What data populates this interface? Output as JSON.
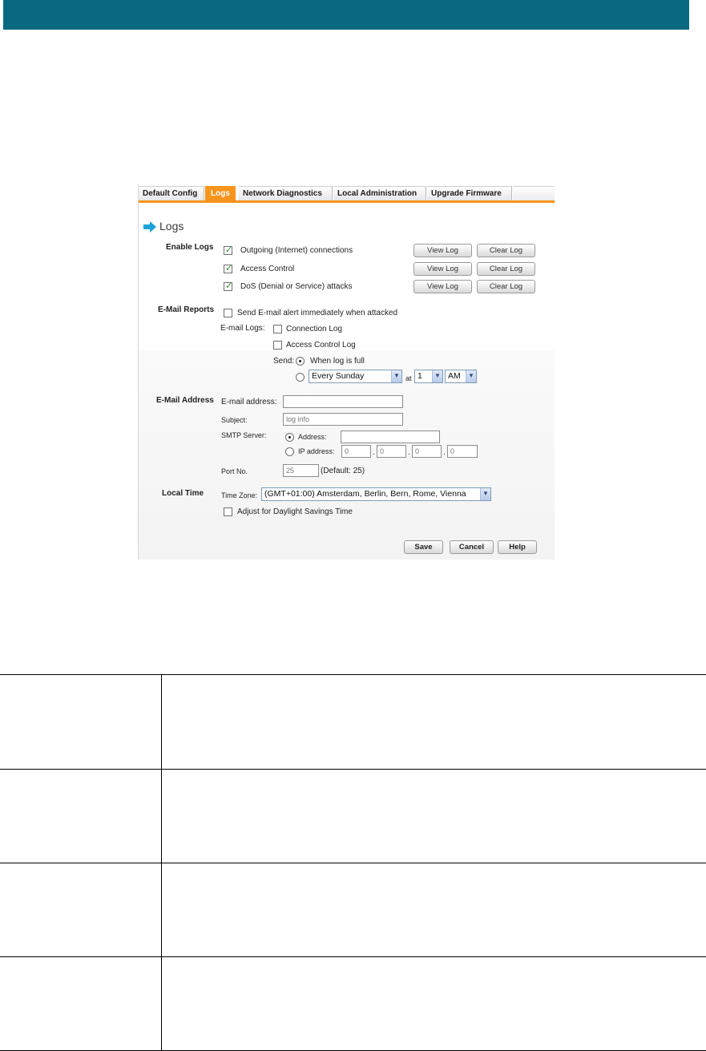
{
  "colors": {
    "header_bar": "#086880",
    "tab_accent": "#f7941d",
    "heading_arrow": "#1aa3d8",
    "checkbox_mark": "#2e8b2e"
  },
  "tabs": [
    {
      "label": "Default Config",
      "active": false
    },
    {
      "label": "Logs",
      "active": true
    },
    {
      "label": "Network Diagnostics",
      "active": false
    },
    {
      "label": "Local Administration",
      "active": false
    },
    {
      "label": "Upgrade Firmware",
      "active": false
    }
  ],
  "page_heading": "Logs",
  "enable_logs": {
    "section_label": "Enable Logs",
    "items": [
      {
        "label": "Outgoing (Internet) connections",
        "checked": true,
        "view": "View Log",
        "clear": "Clear Log"
      },
      {
        "label": "Access Control",
        "checked": true,
        "view": "View Log",
        "clear": "Clear Log"
      },
      {
        "label": "DoS (Denial or Service) attacks",
        "checked": true,
        "view": "View Log",
        "clear": "Clear Log"
      }
    ]
  },
  "email_reports": {
    "section_label": "E-Mail Reports",
    "alert_label": "Send E-mail alert immediately when attacked",
    "alert_checked": false,
    "email_logs_label": "E-mail Logs:",
    "connection_log": "Connection Log",
    "access_control_log": "Access Control Log",
    "send_label": "Send:",
    "when_full": "When log is full",
    "schedule_day": "Every Sunday",
    "at_label": "at",
    "schedule_hour": "1",
    "schedule_ampm": "AM",
    "selected_send_option": "When log is full"
  },
  "email_address": {
    "section_label": "E-Mail Address",
    "email_label": "E-mail address:",
    "email_value": "",
    "subject_label": "Subject:",
    "subject_value": "log info",
    "smtp_label": "SMTP Server:",
    "address_label": "Address:",
    "address_value": "",
    "ip_label": "IP address:",
    "ip_octets": [
      "0",
      "0",
      "0",
      "0"
    ],
    "ip_dot": ".",
    "port_label": "Port No.",
    "port_value": "25",
    "port_default": "(Default: 25)",
    "selected_smtp_option": "Address"
  },
  "local_time": {
    "section_label": "Local Time",
    "timezone_label": "Time Zone:",
    "timezone_value": "(GMT+01:00) Amsterdam, Berlin, Bern, Rome, Vienna",
    "dst_label": "Adjust for Daylight Savings Time",
    "dst_checked": false
  },
  "actions": {
    "save": "Save",
    "cancel": "Cancel",
    "help": "Help"
  }
}
